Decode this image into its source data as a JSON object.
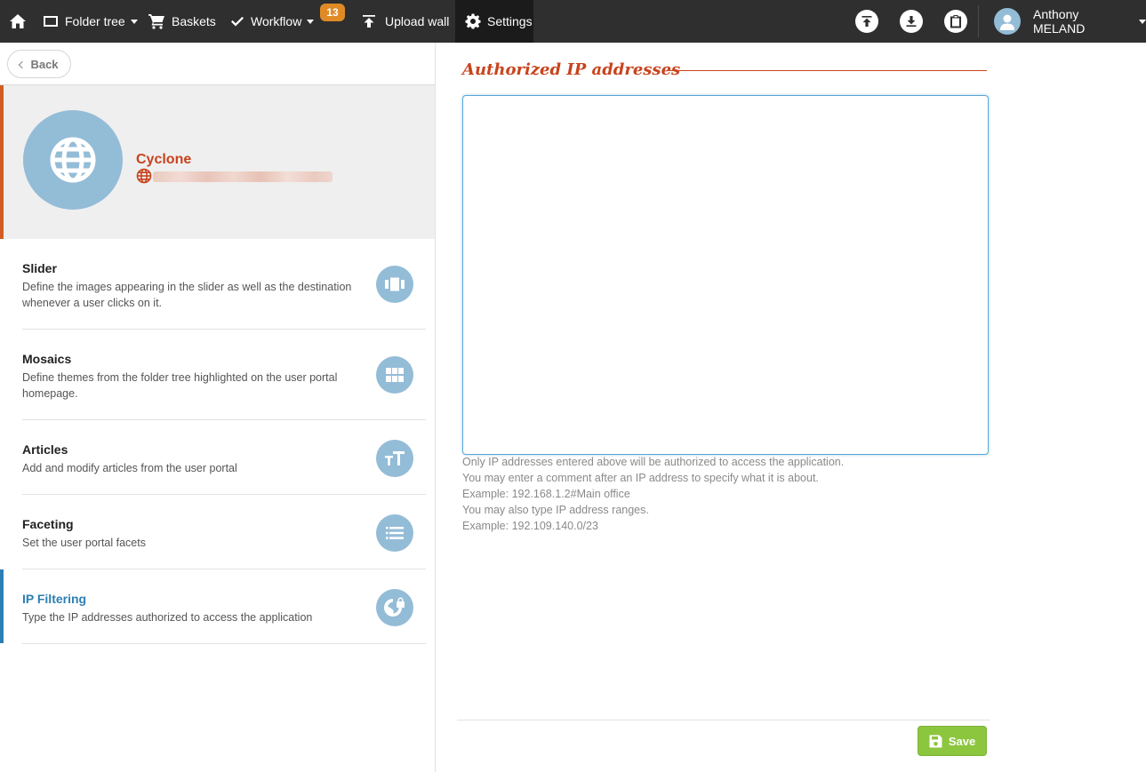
{
  "topnav": {
    "folder_tree_label": "Folder tree",
    "baskets_label": "Baskets",
    "workflow_label": "Workflow",
    "workflow_badge": "13",
    "upload_wall_label": "Upload wall",
    "settings_label": "Settings",
    "user_name": "Anthony MELAND"
  },
  "sidebar": {
    "back_label": "Back",
    "portal": {
      "name": "Cyclone"
    },
    "items": [
      {
        "title": "Slider",
        "description": "Define the images appearing in the slider as well as the destination whenever a user clicks on it.",
        "icon": "slider-icon"
      },
      {
        "title": "Mosaics",
        "description": "Define themes from the folder tree highlighted on the user portal homepage.",
        "icon": "grid-icon"
      },
      {
        "title": "Articles",
        "description": "Add and modify articles from the user portal",
        "icon": "text-size-icon"
      },
      {
        "title": "Faceting",
        "description": "Set the user portal facets",
        "icon": "list-icon"
      },
      {
        "title": "IP Filtering",
        "description": "Type the IP addresses authorized to access the application",
        "icon": "globe-lock-icon",
        "active": true
      }
    ]
  },
  "main": {
    "section_title": "Authorized IP addresses",
    "ip_textarea_value": "",
    "help_lines": [
      "Only IP addresses entered above will be authorized to access the application.",
      "You may enter a comment after an IP address to specify what it is about.",
      "Example: 192.168.1.2#Main office",
      "You may also type IP address ranges.",
      "Example: 192.109.140.0/23"
    ],
    "save_label": "Save"
  },
  "colors": {
    "nav_bg": "#2f2f2f",
    "accent_orange": "#c8431d",
    "accent_blue": "#2d7fb3",
    "icon_bg": "#93bcd7",
    "save_green": "#8cc63f",
    "badge_orange": "#e08a26"
  }
}
